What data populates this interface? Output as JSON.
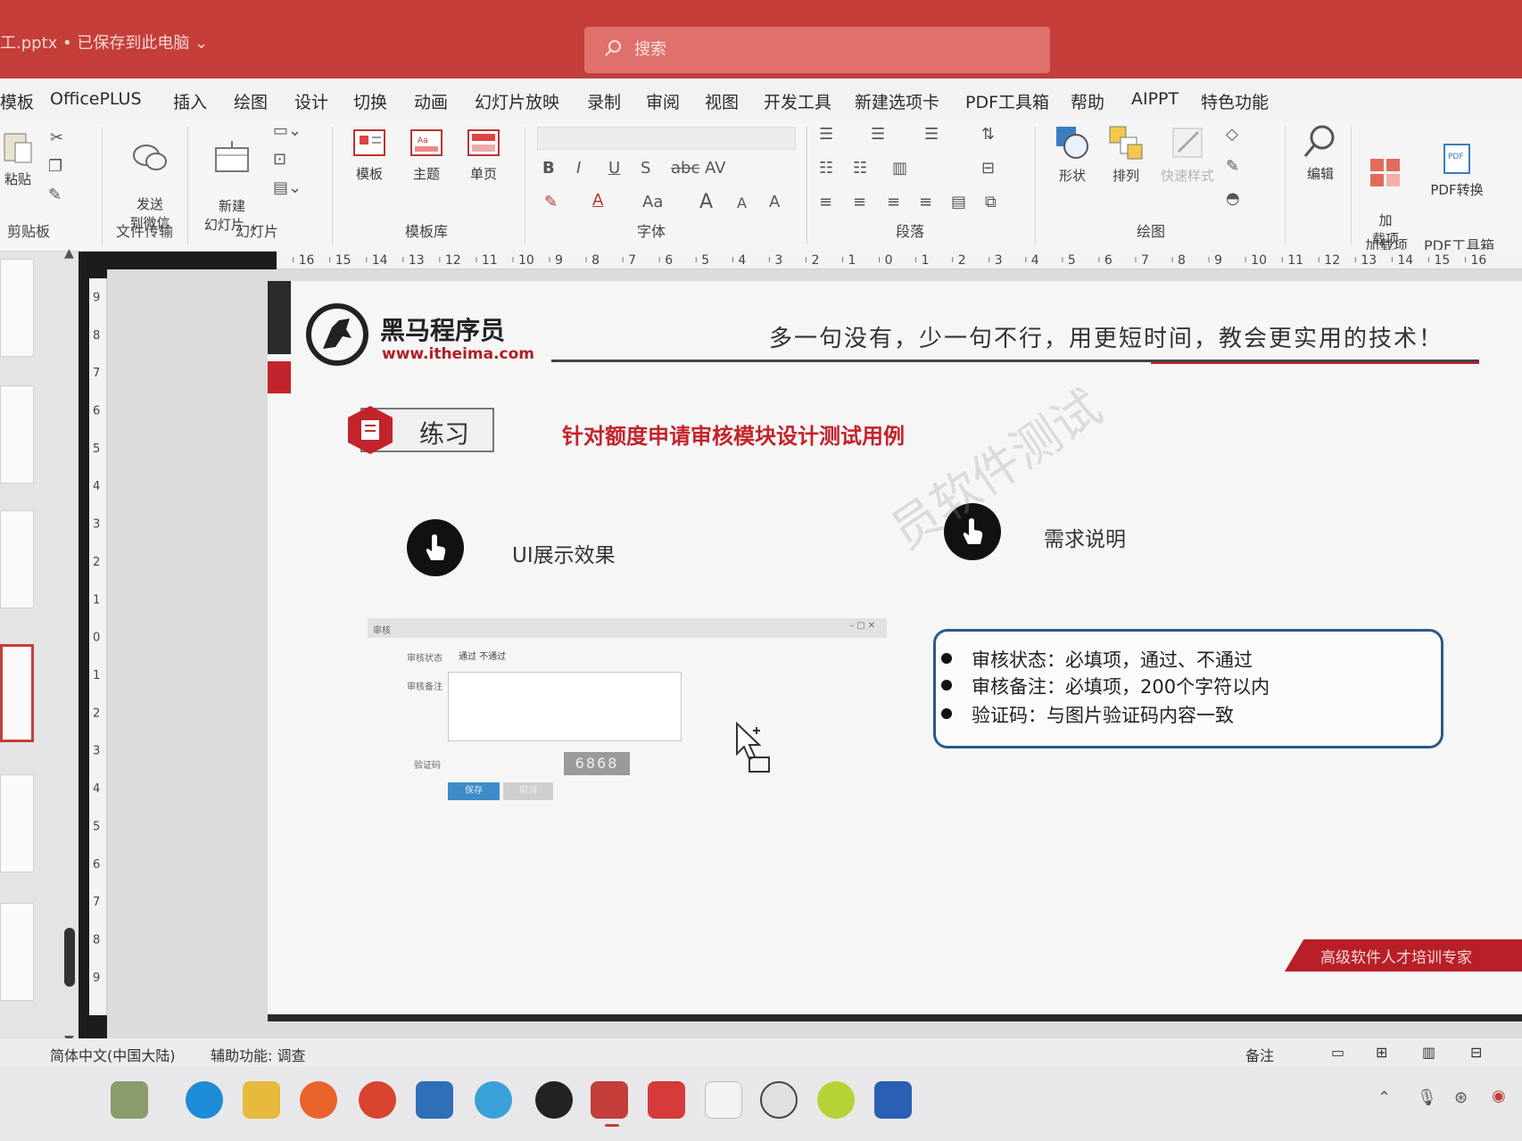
{
  "window": {
    "doc_title": "工.pptx • 已保存到此电脑 ⌄",
    "search_placeholder": "搜索"
  },
  "menu": {
    "tabs": [
      "幻灯片放映",
      "OfficePLUS",
      "插入",
      "绘图",
      "设计",
      "切换",
      "动画",
      "幻灯片放映",
      "录制",
      "审阅",
      "视图",
      "开发工具",
      "新建选项卡",
      "PDF工具箱",
      "帮助",
      "AIPPT",
      "特色功能"
    ],
    "first_tab_visible": "模板"
  },
  "ribbon": {
    "clipboard": {
      "paste": "粘贴",
      "group": "剪贴板"
    },
    "send": {
      "label": "发送\n到微信",
      "group": "文件传输"
    },
    "slides": {
      "new_slide": "新建\n幻灯片 ⌄",
      "group": "幻灯片"
    },
    "templates": {
      "items": [
        "模板",
        "主题",
        "单页"
      ],
      "group": "模板库"
    },
    "font": {
      "group": "字体",
      "bold": "B",
      "italic": "I",
      "underline": "U",
      "strike": "S",
      "spacing": "AV",
      "case": "Aa",
      "grow": "A",
      "shrink": "A",
      "clear": "A"
    },
    "paragraph": {
      "group": "段落"
    },
    "drawing": {
      "shapes": "形状",
      "arrange": "排列",
      "quick_styles": "快速样式",
      "group": "绘图"
    },
    "editing": {
      "label": "编辑"
    },
    "addins": {
      "label": "加\n载项",
      "group": "加载项"
    },
    "pdf": {
      "label": "PDF转换",
      "group": "PDF工具箱"
    }
  },
  "ruler": {
    "h_ticks": [
      "16",
      "15",
      "14",
      "13",
      "12",
      "11",
      "10",
      "9",
      "8",
      "7",
      "6",
      "5",
      "4",
      "3",
      "2",
      "1",
      "0",
      "1",
      "2",
      "3",
      "4",
      "5",
      "6",
      "7",
      "8",
      "9",
      "10",
      "11",
      "12",
      "13",
      "14",
      "15",
      "16"
    ],
    "v_ticks": [
      "9",
      "8",
      "7",
      "6",
      "5",
      "4",
      "3",
      "2",
      "1",
      "0",
      "1",
      "2",
      "3",
      "4",
      "5",
      "6",
      "7",
      "8",
      "9"
    ]
  },
  "slide": {
    "brand_name": "黑马程序员",
    "brand_url": "www.itheima.com",
    "slogan": "多一句没有，少一句不行，用更短时间，教会更实用的技术！",
    "exercise_label": "练习",
    "exercise_title": "针对额度申请审核模块设计测试用例",
    "section_ui": "UI展示效果",
    "section_req": "需求说明",
    "watermark": "员软件测试",
    "mini_ui": {
      "window_title": "审核",
      "status_label": "审核状态",
      "options": "通过   不通过",
      "remark_label": "审核备注",
      "captcha_label": "验证码",
      "captcha": "6868",
      "save": "保存",
      "cancel": "取消"
    },
    "requirements": [
      "审核状态：必填项，通过、不通过",
      "审核备注：必填项，200个字符以内",
      "验证码：与图片验证码内容一致"
    ],
    "footer_banner": "高级软件人才培训专家"
  },
  "statusbar": {
    "language": "简体中文(中国大陆)",
    "accessibility": "辅助功能: 调查",
    "notes": "备注"
  },
  "colors": {
    "title_bar": "#c43e3a",
    "brand_red": "#c3232a",
    "req_border": "#2c5a86",
    "mini_save": "#3d8cc9"
  }
}
